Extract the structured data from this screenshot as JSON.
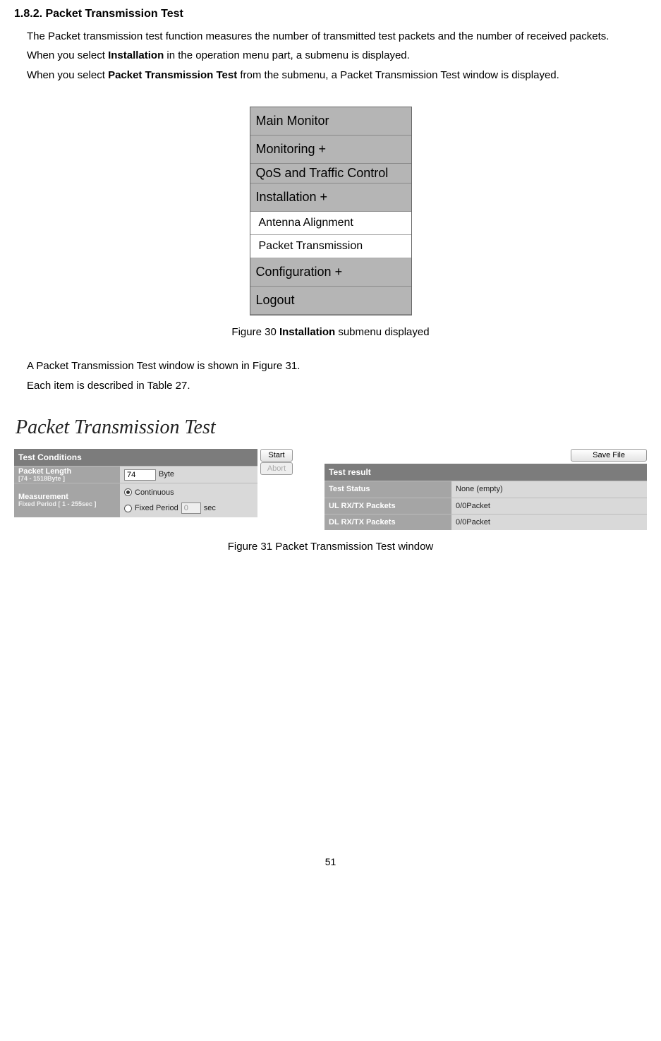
{
  "heading": "1.8.2. Packet Transmission Test",
  "para1_a": "The Packet transmission test function measures the number of transmitted test packets and the number of received packets.",
  "para2_a": "When you select ",
  "para2_bold": "Installation",
  "para2_b": " in the operation menu part, a submenu is displayed.",
  "para3_a": "When you select ",
  "para3_bold": "Packet Transmission Test",
  "para3_b": " from the submenu, a Packet Transmission Test window is displayed.",
  "menu": {
    "items": [
      "Main Monitor",
      "Monitoring +",
      "QoS and Traffic Control",
      "Installation +"
    ],
    "subitems": [
      "Antenna Alignment",
      "Packet Transmission"
    ],
    "items2": [
      "Configuration +",
      "Logout"
    ]
  },
  "fig30_a": "Figure 30 ",
  "fig30_bold": "Installation",
  "fig30_b": " submenu displayed",
  "para4": "A Packet Transmission Test window is shown in Figure 31.",
  "para5": "Each item is described in Table 27.",
  "ptt": {
    "title": "Packet Transmission Test",
    "tc_header": "Test Conditions",
    "pl_label": "Packet Length",
    "pl_sub": "[74 - 1518Byte ]",
    "pl_value": "74",
    "pl_unit": "Byte",
    "meas_label": "Measurement",
    "meas_sub": "Fixed Period [ 1 - 255sec ]",
    "radio1": "Continuous",
    "radio2": "Fixed Period",
    "fp_value": "0",
    "fp_unit": "sec",
    "start_btn": "Start",
    "abort_btn": "Abort",
    "save_btn": "Save File",
    "tr_header": "Test result",
    "r1_label": "Test Status",
    "r1_value": "None (empty)",
    "r2_label": "UL RX/TX Packets",
    "r2_value": "0/0Packet",
    "r3_label": "DL RX/TX Packets",
    "r3_value": "0/0Packet"
  },
  "fig31": "Figure 31 Packet Transmission Test window",
  "page_num": "51"
}
